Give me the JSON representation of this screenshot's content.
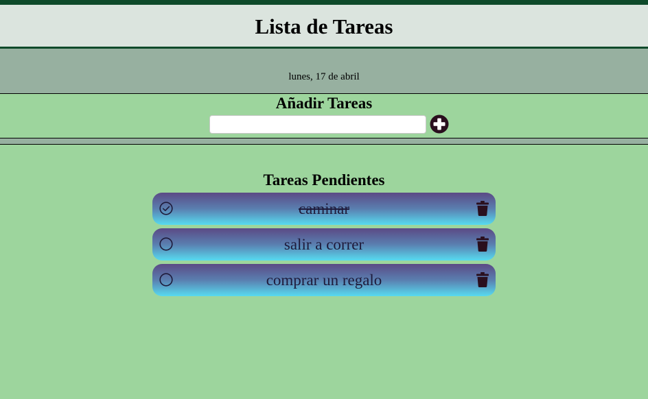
{
  "header": {
    "title": "Lista de Tareas"
  },
  "date": {
    "text": "lunes, 17 de abril"
  },
  "add": {
    "title": "Añadir Tareas",
    "input_value": "",
    "input_placeholder": "",
    "add_icon": "plus-circle-icon"
  },
  "pending": {
    "title": "Tareas Pendientes",
    "tasks": [
      {
        "text": "caminar",
        "done": true,
        "check_icon": "check-circle-icon",
        "delete_icon": "trash-icon"
      },
      {
        "text": "salir a correr",
        "done": false,
        "check_icon": "circle-icon",
        "delete_icon": "trash-icon"
      },
      {
        "text": "comprar un regalo",
        "done": false,
        "check_icon": "circle-icon",
        "delete_icon": "trash-icon"
      }
    ]
  },
  "colors": {
    "top_bar": "#0e4a2a",
    "header_bg": "#dbe4de",
    "band_bg": "#97b0a0",
    "page_bg": "#9dd59d",
    "icon": "#2a0f1e",
    "task_gradient_top": "#5b4a85",
    "task_gradient_bottom": "#57dbf0"
  }
}
